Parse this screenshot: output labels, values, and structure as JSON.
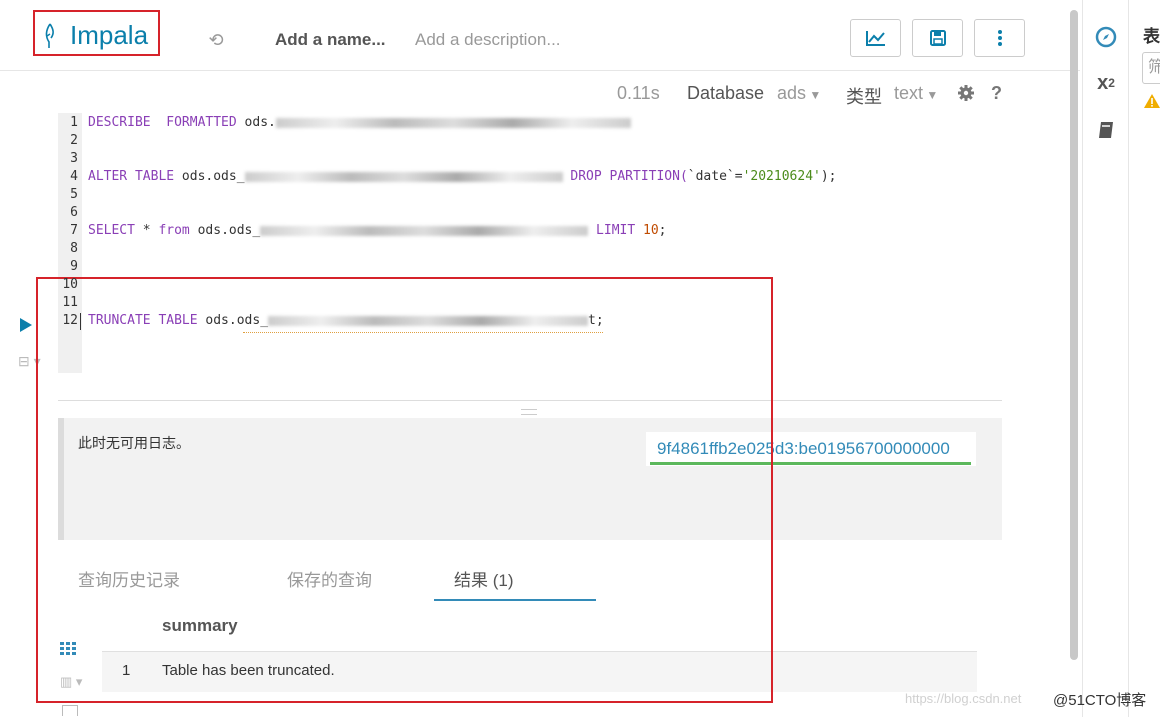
{
  "header": {
    "logo_text": "Impala",
    "name_placeholder": "Add a name...",
    "description_placeholder": "Add a description..."
  },
  "status": {
    "elapsed": "0.11s",
    "database_label": "Database",
    "database_value": "ads",
    "type_label": "类型",
    "type_value": "text",
    "help": "?"
  },
  "editor": {
    "line_numbers": [
      "1",
      "2",
      "3",
      "4",
      "5",
      "6",
      "7",
      "8",
      "9",
      "10",
      "11",
      "12"
    ],
    "lines": {
      "l1_kw": "DESCRIBE  FORMATTED",
      "l1_pl": " ods.",
      "l4_kw1": "ALTER TABLE",
      "l4_pl": " ods.ods_",
      "l4_kw2": " DROP PARTITION(",
      "l4_pl2": "`date`=",
      "l4_st": "'20210624'",
      "l4_end": ");",
      "l7_kw": "SELECT",
      "l7_pl": " * ",
      "l7_kw2": "from",
      "l7_pl2": " ods.ods_",
      "l7_kw3": " LIMIT ",
      "l7_nm": "10",
      "l7_end": ";",
      "l12_kw": "TRUNCATE TABLE",
      "l12_pl": " ods.ods_",
      "l12_end": "t;"
    }
  },
  "logs": {
    "message": "此时无可用日志。",
    "query_id": "9f4861ffb2e025d3:be01956700000000"
  },
  "tabs": [
    {
      "label": "查询历史记录"
    },
    {
      "label": "保存的查询"
    },
    {
      "label": "结果 (1)"
    }
  ],
  "results": {
    "column": "summary",
    "rows": [
      {
        "index": "1",
        "value": "Table has been truncated."
      }
    ]
  },
  "assist": {
    "header": "表",
    "filter_placeholder": "筛"
  },
  "watermark": {
    "url": "https://blog.csdn.net",
    "brand": "@51CTO博客"
  },
  "colors": {
    "accent": "#338bb8",
    "keyword": "#8a3fb6",
    "string": "#4b8b1b",
    "highlight_box": "#d6232a"
  }
}
